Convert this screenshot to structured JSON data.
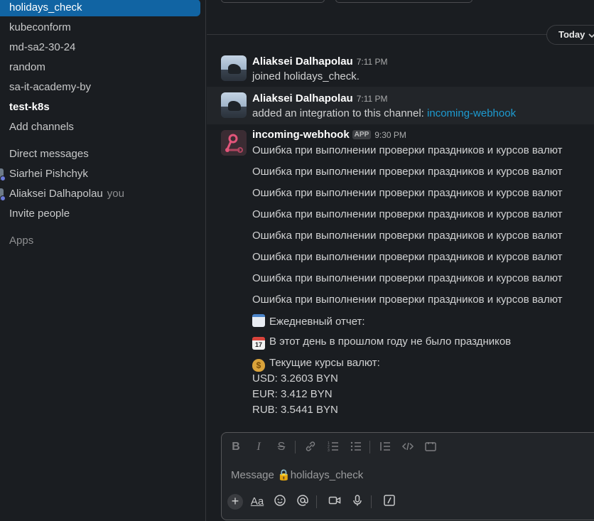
{
  "sidebar": {
    "channels": [
      {
        "label": "holidays_check"
      },
      {
        "label": "kubeconform"
      },
      {
        "label": "md-sa2-30-24"
      },
      {
        "label": "random"
      },
      {
        "label": "sa-it-academy-by"
      },
      {
        "label": "test-k8s"
      }
    ],
    "add_channels": "Add channels",
    "dm_header": "Direct messages",
    "dms": [
      {
        "label": "Siarhei Pishchyk"
      },
      {
        "label": "Aliaksei Dalhapolau",
        "suffix": "you"
      }
    ],
    "invite": "Invite people",
    "apps": "Apps"
  },
  "main": {
    "date_divider": "Today",
    "messages": [
      {
        "author": "Aliaksei Dalhapolau",
        "time": "7:11 PM",
        "text": "joined holidays_check."
      },
      {
        "author": "Aliaksei Dalhapolau",
        "time": "7:11 PM",
        "text": "added an integration to this channel: ",
        "link": "incoming-webhook"
      },
      {
        "author": "incoming-webhook",
        "badge": "APP",
        "time": "9:30 PM",
        "lines": [
          "Ошибка при выполнении проверки праздников и курсов валют",
          "Ошибка при выполнении проверки праздников и курсов валют",
          "Ошибка при выполнении проверки праздников и курсов валют",
          "Ошибка при выполнении проверки праздников и курсов валют",
          "Ошибка при выполнении проверки праздников и курсов валют",
          "Ошибка при выполнении проверки праздников и курсов валют",
          "Ошибка при выполнении проверки праздников и курсов валют",
          "Ошибка при выполнении проверки праздников и курсов валют"
        ],
        "report": "Ежедневный отчет:",
        "calendar_day": "17",
        "calendar_month": "JULY",
        "no_holidays": "В этот день в прошлом году не было праздников",
        "rates_header": "Текущие курсы валют:",
        "rates": [
          "USD: 3.2603 BYN",
          "EUR: 3.412 BYN",
          "RUB: 3.5441 BYN"
        ]
      }
    ]
  },
  "composer": {
    "placeholder": "Message 🔒holidays_check",
    "aa_label": "Aa"
  }
}
